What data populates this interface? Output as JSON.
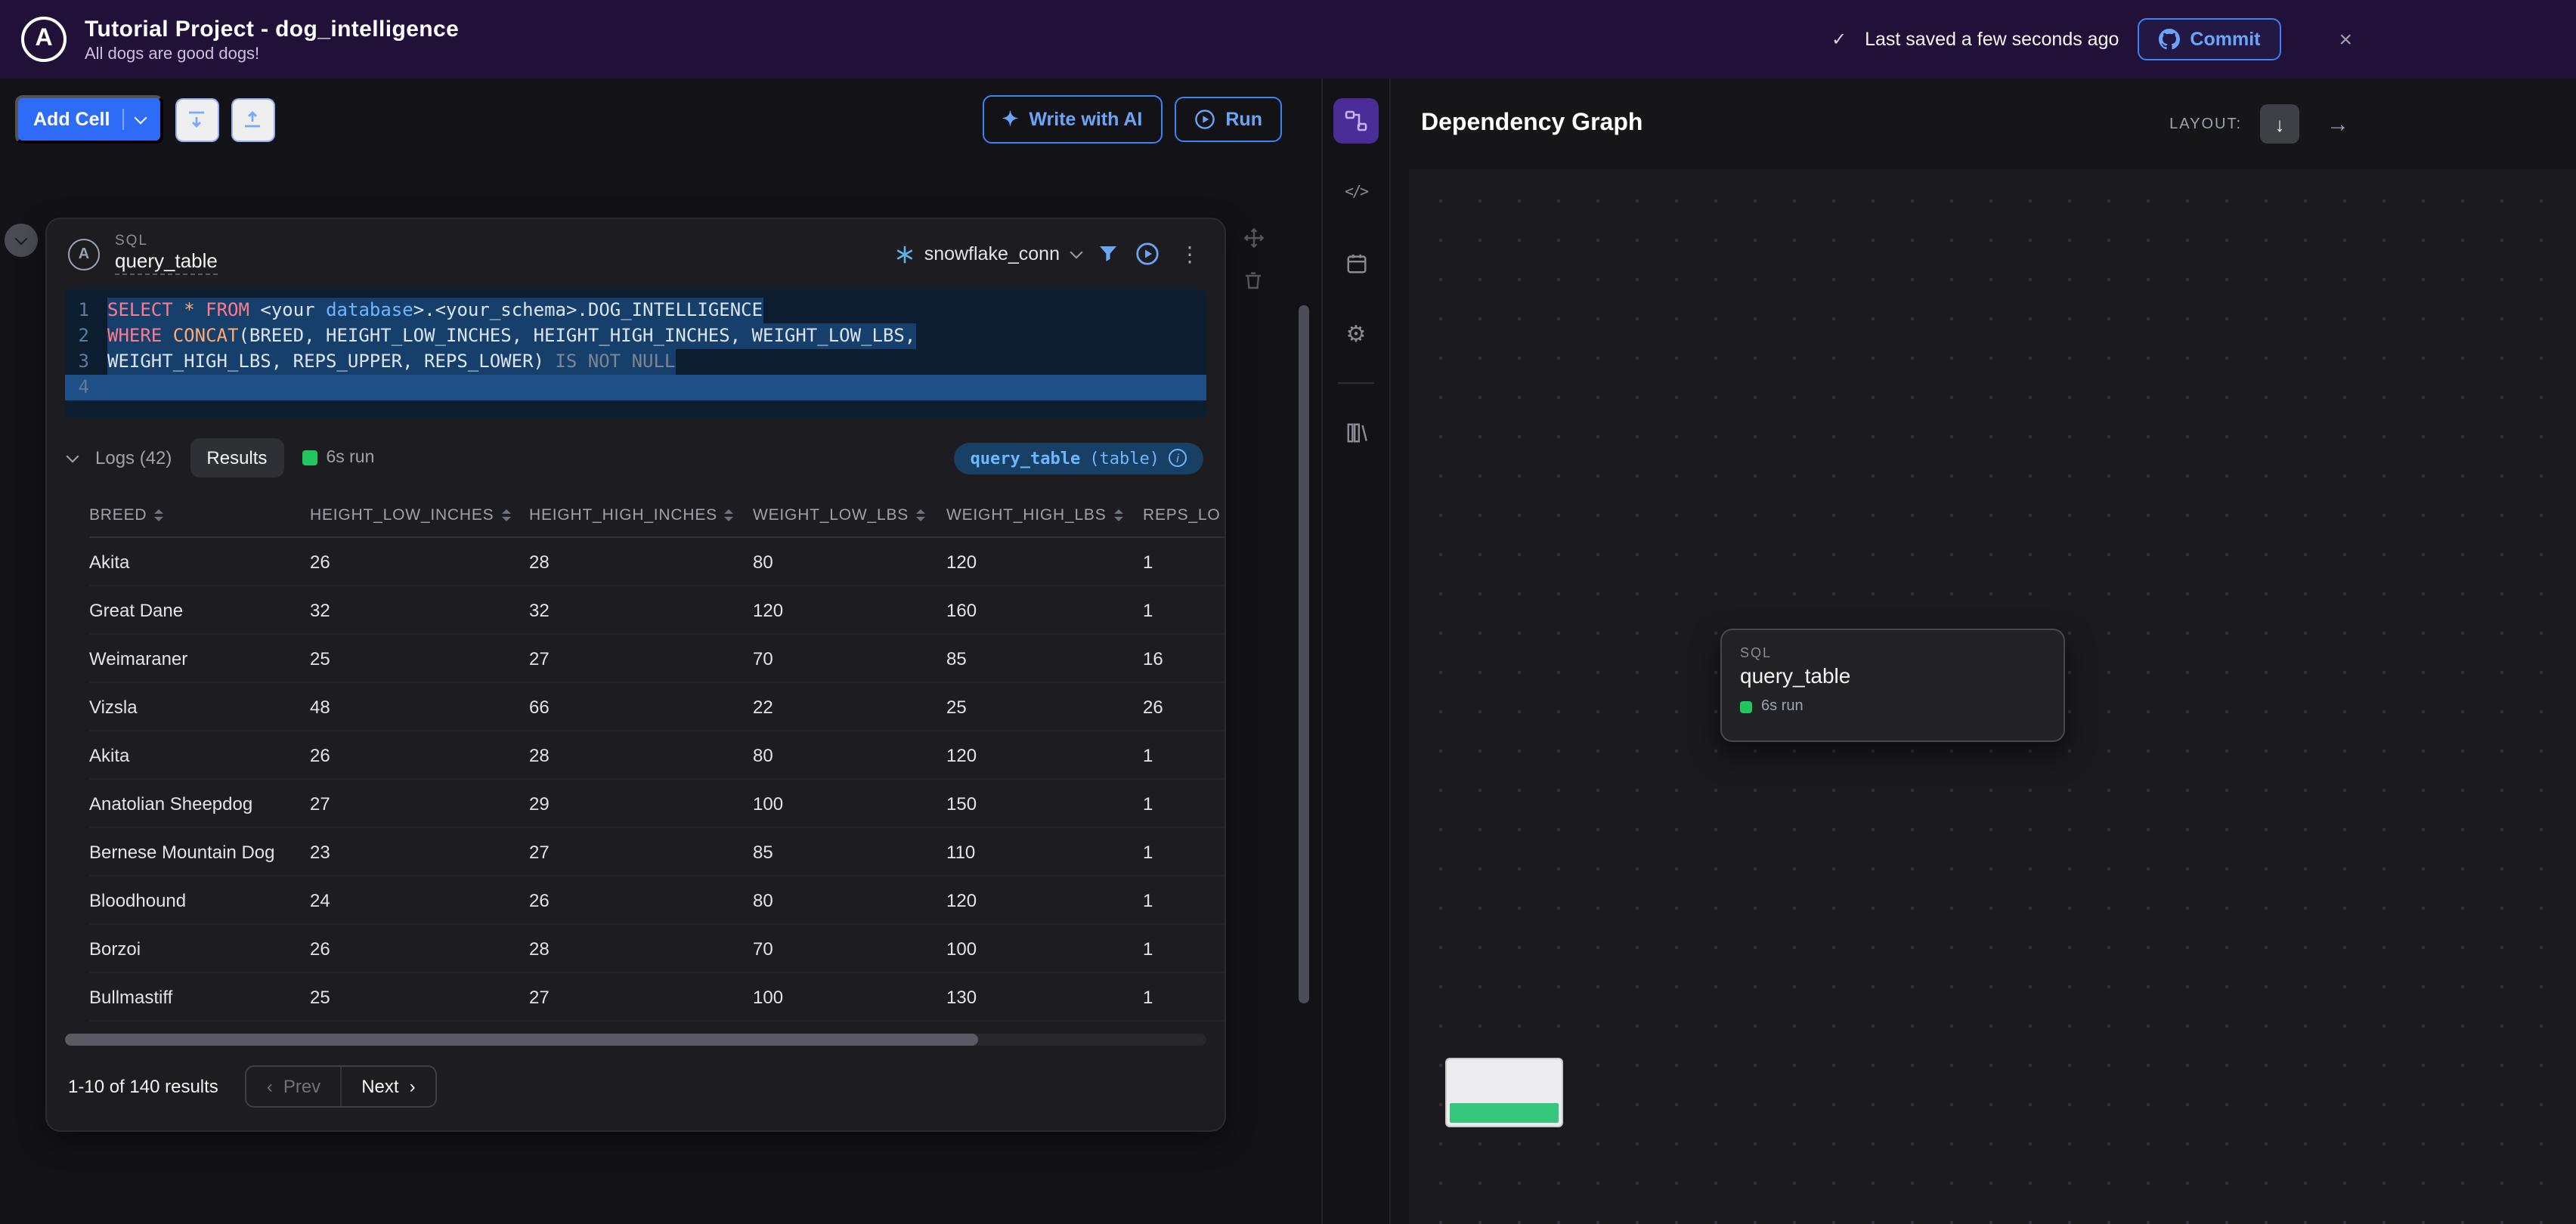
{
  "icons": {
    "check": "✓",
    "close": "×",
    "kebab": "⋮",
    "gear": "⚙",
    "sparkle": "✦",
    "arrow_down": "↓",
    "arrow_right": "→",
    "chev_prev": "‹",
    "chev_next": "›",
    "code": "</>",
    "info": "i",
    "logo": "A"
  },
  "colors": {
    "accent_blue": "#3b82f6",
    "green": "#22c55e",
    "purple": "#4a2d96",
    "header_purple": "#211139"
  },
  "header": {
    "title": "Tutorial Project - dog_intelligence",
    "subtitle": "All dogs are good dogs!",
    "saved_status": "Last saved a few seconds ago",
    "commit_label": "Commit"
  },
  "toolbar": {
    "add_cell_label": "Add Cell",
    "write_with_ai_label": "Write with AI",
    "run_label": "Run"
  },
  "cell": {
    "type_label": "SQL",
    "name": "query_table",
    "connection_name": "snowflake_conn",
    "code_lines": [
      {
        "num": "1",
        "state": "sel",
        "tokens": [
          [
            "kw",
            "SELECT"
          ],
          [
            "plain",
            " "
          ],
          [
            "fn",
            "*"
          ],
          [
            "plain",
            " "
          ],
          [
            "kw",
            "FROM"
          ],
          [
            "plain",
            " <your "
          ],
          [
            "type",
            "database"
          ],
          [
            "plain",
            ">.<your_schema>.DOG_INTELLIGENCE"
          ]
        ]
      },
      {
        "num": "2",
        "state": "sel",
        "tokens": [
          [
            "kw",
            "WHERE"
          ],
          [
            "plain",
            " "
          ],
          [
            "fn",
            "CONCAT"
          ],
          [
            "plain",
            "(BREED, HEIGHT_LOW_INCHES, HEIGHT_HIGH_INCHES, WEIGHT_LOW_LBS,"
          ]
        ]
      },
      {
        "num": "3",
        "state": "sel",
        "tokens": [
          [
            "plain",
            "WEIGHT_HIGH_LBS, REPS_UPPER, REPS_LOWER)"
          ],
          [
            "dim",
            " IS NOT NULL"
          ]
        ]
      },
      {
        "num": "4",
        "state": "active",
        "tokens": []
      }
    ],
    "results_bar": {
      "logs_label": "Logs (42)",
      "results_label": "Results",
      "run_status": "6s run",
      "badge_name": "query_table",
      "badge_type": "(table)"
    },
    "table": {
      "columns": [
        "BREED",
        "HEIGHT_LOW_INCHES",
        "HEIGHT_HIGH_INCHES",
        "WEIGHT_LOW_LBS",
        "WEIGHT_HIGH_LBS",
        "REPS_LO"
      ],
      "rows": [
        [
          "Akita",
          "26",
          "28",
          "80",
          "120",
          "1"
        ],
        [
          "Great Dane",
          "32",
          "32",
          "120",
          "160",
          "1"
        ],
        [
          "Weimaraner",
          "25",
          "27",
          "70",
          "85",
          "16"
        ],
        [
          "Vizsla",
          "48",
          "66",
          "22",
          "25",
          "26"
        ],
        [
          "Akita",
          "26",
          "28",
          "80",
          "120",
          "1"
        ],
        [
          "Anatolian Sheepdog",
          "27",
          "29",
          "100",
          "150",
          "1"
        ],
        [
          "Bernese Mountain Dog",
          "23",
          "27",
          "85",
          "110",
          "1"
        ],
        [
          "Bloodhound",
          "24",
          "26",
          "80",
          "120",
          "1"
        ],
        [
          "Borzoi",
          "26",
          "28",
          "70",
          "100",
          "1"
        ],
        [
          "Bullmastiff",
          "25",
          "27",
          "100",
          "130",
          "1"
        ]
      ]
    },
    "pagination": {
      "summary": "1-10 of 140 results",
      "prev_label": "Prev",
      "next_label": "Next"
    }
  },
  "right_panel": {
    "title": "Dependency Graph",
    "layout_label": "LAYOUT:",
    "node": {
      "type_label": "SQL",
      "name": "query_table",
      "status": "6s run"
    }
  }
}
